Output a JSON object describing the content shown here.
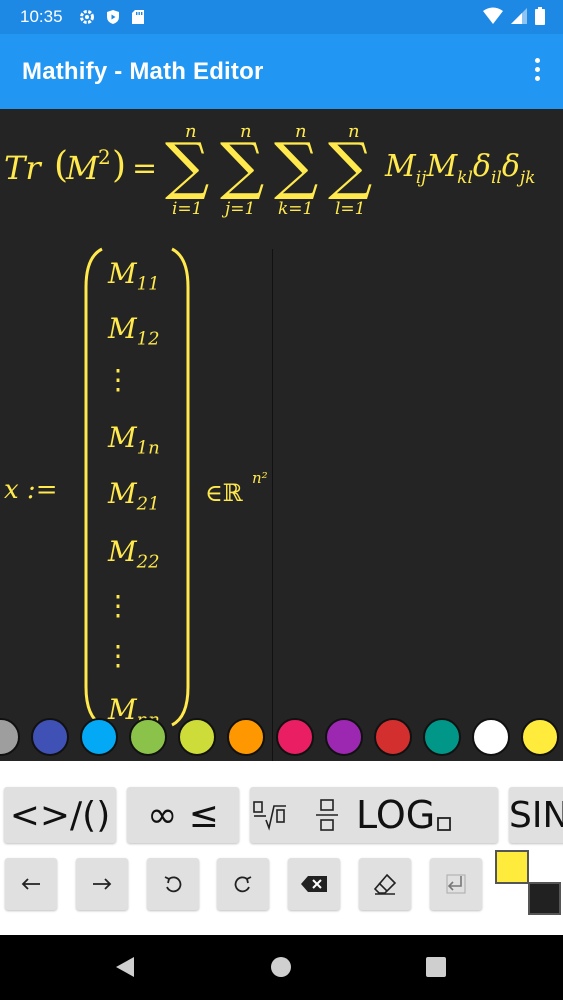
{
  "status_bar": {
    "time": "10:35"
  },
  "app_bar": {
    "title": "Mathify - Math Editor"
  },
  "equation1": {
    "lhs": "Tr",
    "upper_limit": "n",
    "indices": [
      "i=1",
      "j=1",
      "k=1",
      "l=1"
    ]
  },
  "equation2": {
    "lhs": "x :=",
    "entries": [
      "M11",
      "M12",
      "⋮",
      "M1n",
      "M21",
      "M22",
      "⋮",
      "⋮",
      "Mnn"
    ],
    "membership": "∈ℝ"
  },
  "colors": [
    "#9e9e9e",
    "#3f51b5",
    "#03a9f4",
    "#8bc34a",
    "#cddc39",
    "#ff9800",
    "#e91e63",
    "#9c27b0",
    "#d32f2f",
    "#009688",
    "#ffffff",
    "#ffeb3b"
  ],
  "keyboard": {
    "row1": [
      "<>/()",
      "∞ ≤",
      "LOG",
      "SIN"
    ],
    "row2_icons": [
      "arrow-left",
      "arrow-right",
      "undo",
      "redo",
      "backspace",
      "eraser",
      "enter"
    ]
  },
  "active_colors": {
    "foreground": "#ffeb3b",
    "background": "#212121"
  }
}
